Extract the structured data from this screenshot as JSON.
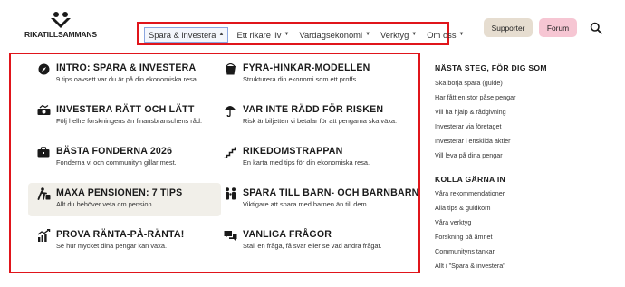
{
  "brand": {
    "name": "RIKATILLSAMMANS"
  },
  "nav": {
    "items": [
      {
        "label": "Spara & investera"
      },
      {
        "label": "Ett rikare liv"
      },
      {
        "label": "Vardagsekonomi"
      },
      {
        "label": "Verktyg"
      },
      {
        "label": "Om oss"
      }
    ]
  },
  "header": {
    "supporter_label": "Supporter",
    "forum_label": "Forum"
  },
  "menu": {
    "items": [
      {
        "title": "INTRO: SPARA & INVESTERA",
        "desc": "9 tips oavsett var du är på din ekonomiska resa.",
        "icon": "compass-icon"
      },
      {
        "title": "FYRA-HINKAR-MODELLEN",
        "desc": "Strukturera din ekonomi som ett proffs.",
        "icon": "bucket-icon"
      },
      {
        "title": "INVESTERA RÄTT OCH LÄTT",
        "desc": "Följ hellre forskningens än finansbranschens råd.",
        "icon": "money-icon"
      },
      {
        "title": "VAR INTE RÄDD FÖR RISKEN",
        "desc": "Risk är biljetten vi betalar för att pengarna ska växa.",
        "icon": "umbrella-icon"
      },
      {
        "title": "BÄSTA FONDERNA 2026",
        "desc": "Fonderna vi och communityn gillar mest.",
        "icon": "briefcase-icon"
      },
      {
        "title": "RIKEDOMSTRAPPAN",
        "desc": "En karta med tips för din ekonomiska resa.",
        "icon": "stairs-icon"
      },
      {
        "title": "MAXA PENSIONEN: 7 TIPS",
        "desc": "Allt du behöver veta om pension.",
        "icon": "walker-icon"
      },
      {
        "title": "SPARA TILL BARN- OCH BARNBARN",
        "desc": "Viktigare att spara med barnen än till dem.",
        "icon": "family-icon"
      },
      {
        "title": "PROVA RÄNTA-PÅ-RÄNTA!",
        "desc": "Se hur mycket dina pengar kan växa.",
        "icon": "growth-chart-icon"
      },
      {
        "title": "VANLIGA FRÅGOR",
        "desc": "Ställ en fråga, få svar eller se vad andra frågat.",
        "icon": "chat-bubbles-icon"
      }
    ]
  },
  "sidebar": {
    "next_heading": "NÄSTA STEG, FÖR DIG SOM",
    "next_links": [
      "Ska börja spara (guide)",
      "Har fått en stor påse pengar",
      "Vill ha hjälp & rådgivning",
      "Investerar via företaget",
      "Investerar i enskilda aktier",
      "Vill leva på dina pengar"
    ],
    "check_heading": "KOLLA GÄRNA IN",
    "check_links": [
      "Våra rekommendationer",
      "Alla tips & guldkorn",
      "Våra verktyg",
      "Forskning på ämnet",
      "Communityns tankar",
      "Allt i \"Spara & investera\""
    ]
  }
}
